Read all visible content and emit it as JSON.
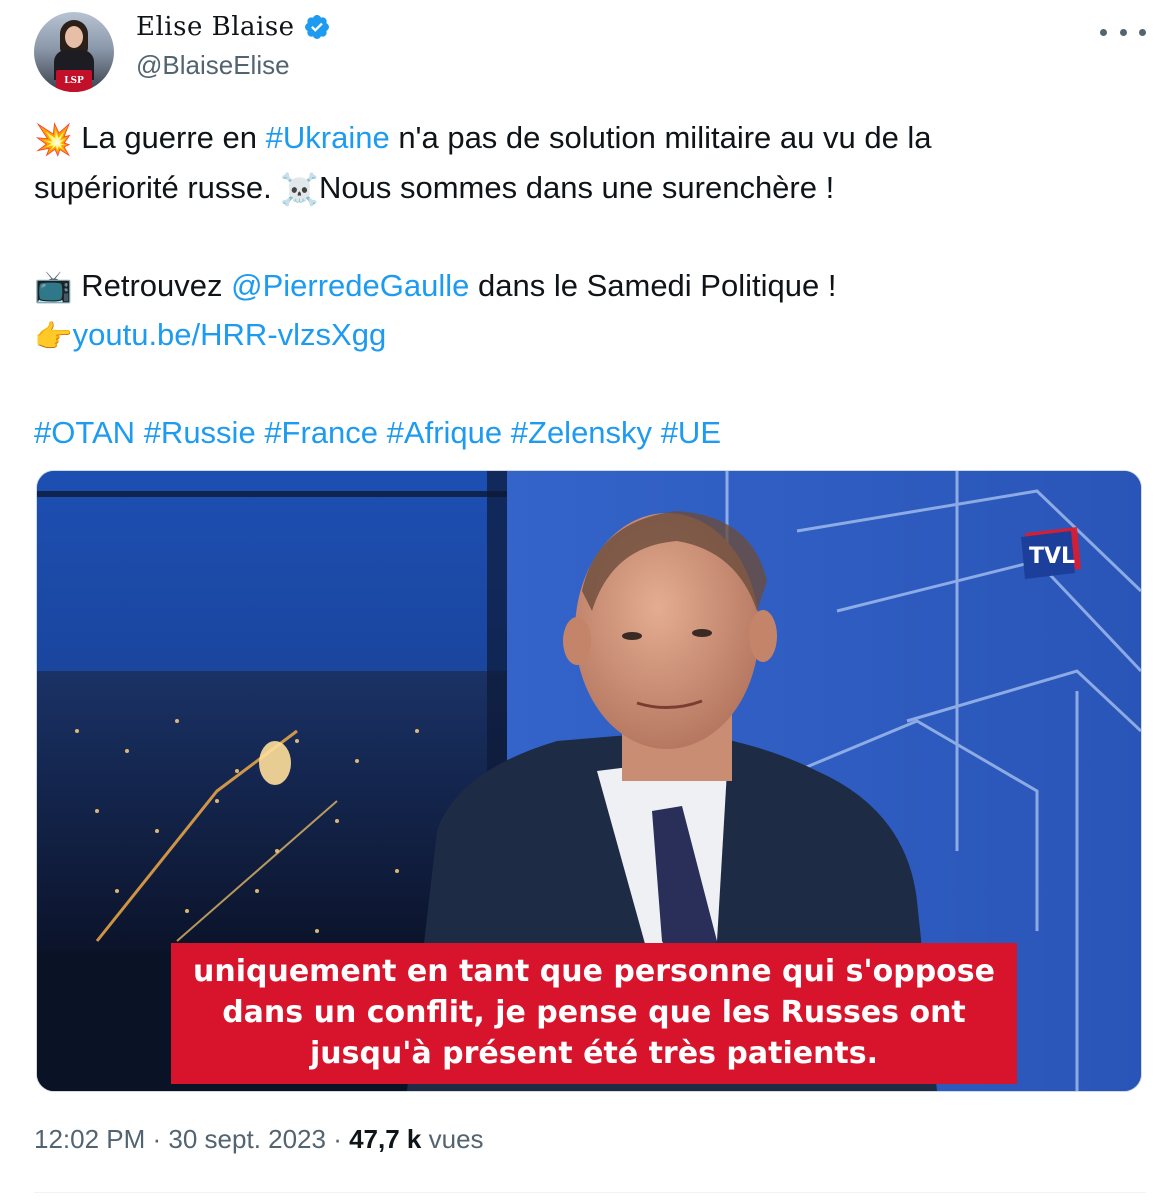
{
  "author": {
    "display_name": "Elise Blaise",
    "handle": "@BlaiseElise",
    "verified": true,
    "avatar_badge": "LSP"
  },
  "tweet": {
    "line1_emoji": "💥",
    "line1_pre": " La guerre en ",
    "line1_hashtag": "#Ukraine",
    "line1_post": " n'a pas de solution militaire au vu de la",
    "line2_pre": "supériorité russe. ",
    "line2_emoji": "☠️",
    "line2_post": "Nous sommes dans une surenchère !",
    "line3_emoji": "📺",
    "line3_pre": " Retrouvez ",
    "line3_mention": "@PierredeGaulle",
    "line3_post": " dans le Samedi Politique !",
    "line4_emoji": "👉",
    "line4_link": "youtu.be/HRR-vlzsXgg",
    "hashtags": [
      "#OTAN",
      "#Russie",
      "#France",
      "#Afrique",
      "#Zelensky",
      "#UE"
    ]
  },
  "media": {
    "channel_logo": "TVL",
    "subtitle_lines": [
      "uniquement en tant que personne qui s'oppose",
      "dans un conflit, je pense que les Russes ont",
      "jusqu'à présent été très patients."
    ]
  },
  "footer": {
    "time": "12:02 PM",
    "separator": " · ",
    "date": "30 sept. 2023",
    "views_count": "47,7 k",
    "views_label": " vues"
  },
  "colors": {
    "link": "#1d9bf0",
    "subtitle_bg": "#d7142b",
    "muted": "#536471"
  }
}
